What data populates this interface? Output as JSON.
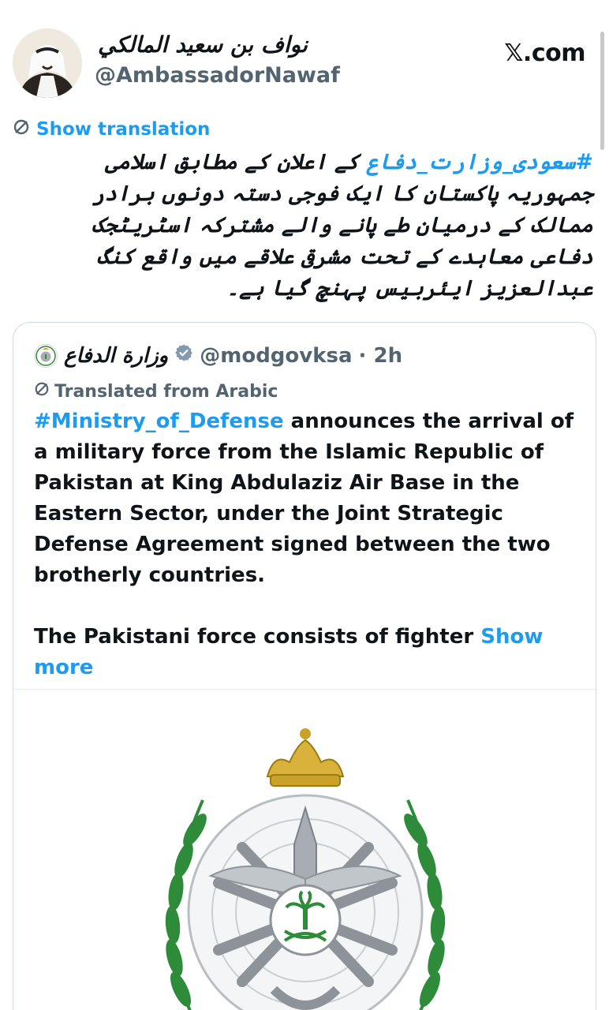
{
  "header": {
    "name": "نواف بن سعيد المالكي",
    "handle": "@AmbassadorNawaf",
    "site": "𝕏.com"
  },
  "tweet": {
    "show_translation": "Show translation",
    "hashtag": "#سعودی_وزارت_دفاع",
    "body": " کے اعلان کے مطابق اسلامی جمہوریہ پاکستان کا ایک فوجی دستہ دونوں برادر ممالک کے درمیان طے پانے والے مشترکہ اسٹریٹجک دفاعی معاہدے کے تحت مشرقی علاقے میں واقع کنگ عبدالعزیز ایئربیس پہنچ گیا ہے۔"
  },
  "quote": {
    "name": "وزارة الدفاع",
    "handle": "@modgovksa",
    "time": "· 2h",
    "translated_label": "Translated from Arabic",
    "hashtag": "#Ministry_of_Defense",
    "para1": " announces the arrival of a military force from the Islamic Republic of Pakistan at King Abdulaziz Air Base in the Eastern Sector, under the Joint Strategic Defense Agreement signed between the two brotherly countries.",
    "para2": "The Pakistani force consists of fighter ",
    "show_more": "Show more"
  },
  "icons": {
    "translate": "globe-slash-icon",
    "verified": "verified-badge-icon"
  },
  "colors": {
    "accent": "#1d9bf0",
    "muted": "#536471",
    "emblem_green": "#2e8b3a",
    "emblem_gold": "#c9a227",
    "emblem_grey": "#a7adb3"
  }
}
